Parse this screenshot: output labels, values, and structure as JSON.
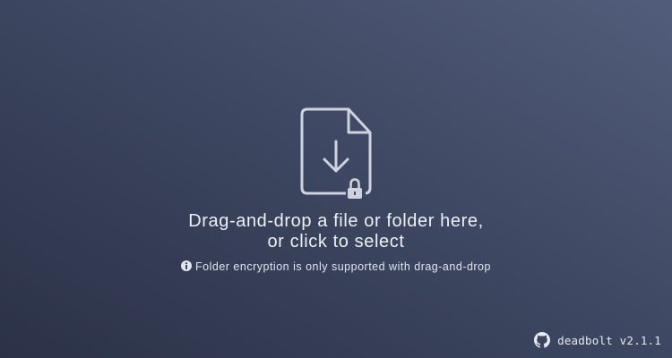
{
  "dropzone": {
    "line1": "Drag-and-drop a file or folder here,",
    "line2": "or click to select",
    "note": "Folder encryption is only supported with drag-and-drop",
    "icon": "file-download-lock-icon",
    "note_icon": "info-icon"
  },
  "footer": {
    "app_version": "deadbolt v2.1.1",
    "repo_icon": "github-icon"
  },
  "colors": {
    "background_start": "#2b3247",
    "background_end": "#515d7a",
    "icon_stroke": "#cfd3dd",
    "text": "#eef0f5"
  }
}
